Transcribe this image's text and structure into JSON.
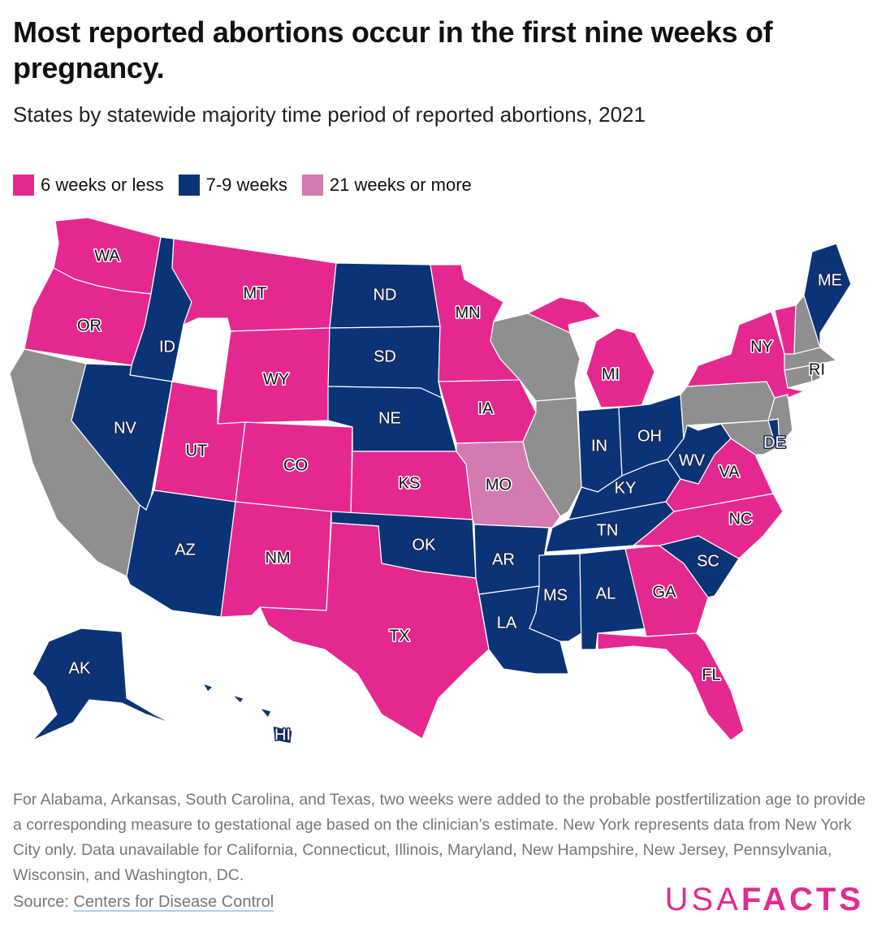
{
  "title": "Most reported abortions occur in the first nine weeks of pregnancy.",
  "subtitle": "States by statewide majority time period of reported abortions, 2021",
  "colors": {
    "6_or_less": "#e5288f",
    "7_9": "#0b3478",
    "21_plus": "#d37ab0",
    "na": "#8f8f8f"
  },
  "legend": [
    {
      "key": "6_or_less",
      "label": "6 weeks or less"
    },
    {
      "key": "7_9",
      "label": "7-9 weeks"
    },
    {
      "key": "21_plus",
      "label": "21 weeks or more"
    }
  ],
  "states": {
    "WA": "6_or_less",
    "OR": "6_or_less",
    "CA": "na",
    "ID": "7_9",
    "NV": "7_9",
    "MT": "6_or_less",
    "WY": "6_or_less",
    "UT": "6_or_less",
    "AZ": "7_9",
    "CO": "6_or_less",
    "NM": "6_or_less",
    "ND": "7_9",
    "SD": "7_9",
    "NE": "7_9",
    "KS": "6_or_less",
    "OK": "7_9",
    "TX": "6_or_less",
    "MN": "6_or_less",
    "IA": "6_or_less",
    "MO": "21_plus",
    "AR": "7_9",
    "LA": "7_9",
    "WI": "na",
    "IL": "na",
    "MI": "6_or_less",
    "IN": "7_9",
    "OH": "7_9",
    "KY": "7_9",
    "TN": "7_9",
    "MS": "7_9",
    "AL": "7_9",
    "GA": "6_or_less",
    "FL": "6_or_less",
    "SC": "7_9",
    "NC": "6_or_less",
    "VA": "6_or_less",
    "WV": "7_9",
    "MD": "na",
    "DE": "7_9",
    "PA": "na",
    "NJ": "na",
    "NY": "6_or_less",
    "CT": "na",
    "RI": "na",
    "MA": "na",
    "VT": "6_or_less",
    "NH": "na",
    "ME": "7_9",
    "AK": "7_9",
    "HI": "7_9"
  },
  "note": "For Alabama, Arkansas, South Carolina, and Texas, two weeks were added to the probable postfertilization age to provide a corresponding measure to gestational age based on the clinician’s estimate. New York represents data from New York City only. Data unavailable for California, Connecticut, Illinois, Maryland, New Hampshire, New Jersey, Pennsylvania, Wisconsin, and Washington, DC.",
  "source_prefix": "Source: ",
  "source_link": "Centers for Disease Control",
  "logo": {
    "part1": "USA",
    "part2": "FACTS"
  }
}
